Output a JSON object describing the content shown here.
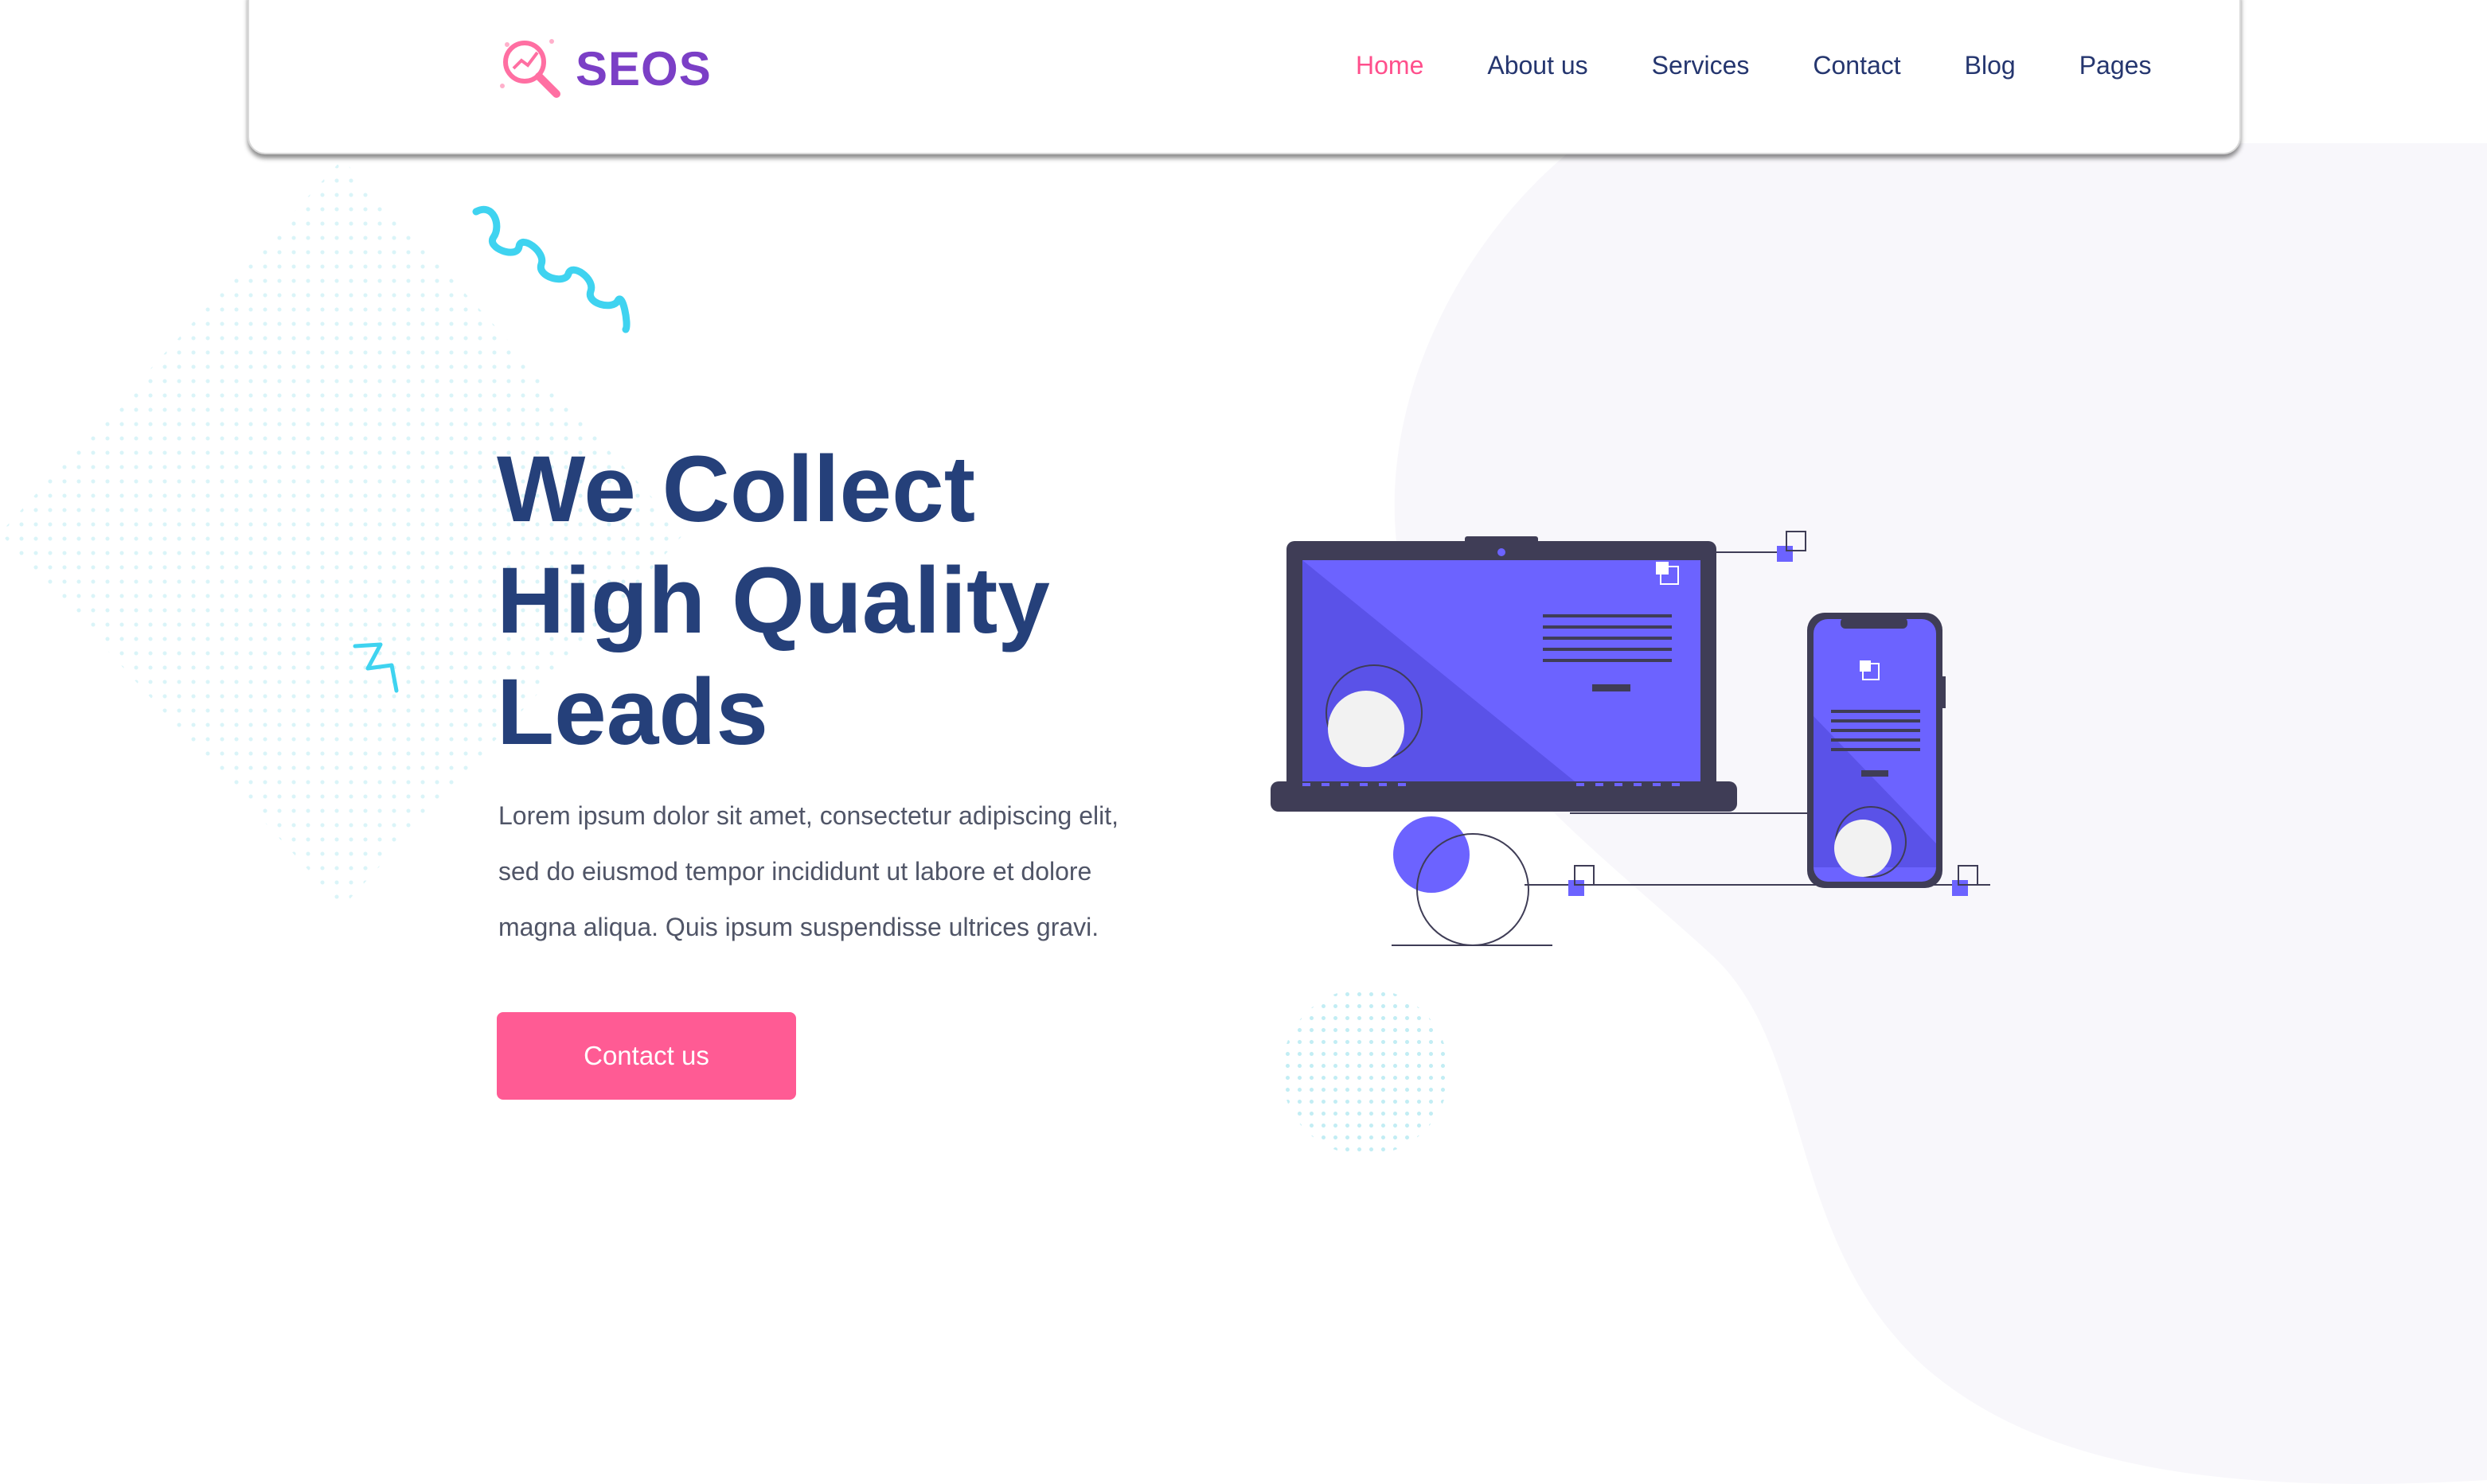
{
  "brand": {
    "name": "SEOS",
    "color": "#7b3fc6",
    "logo_icon": "magnifier-chart-icon",
    "logo_icon_color": "#ff6fa2"
  },
  "nav": {
    "items": [
      {
        "label": "Home",
        "active": true
      },
      {
        "label": "About us",
        "active": false
      },
      {
        "label": "Services",
        "active": false
      },
      {
        "label": "Contact",
        "active": false
      },
      {
        "label": "Blog",
        "active": false
      },
      {
        "label": "Pages",
        "active": false
      }
    ],
    "active_color": "#ff4f8c",
    "text_color": "#25366f"
  },
  "hero": {
    "title_lines": [
      "We Collect",
      "High Quality",
      "Leads"
    ],
    "description_lines": [
      "Lorem ipsum dolor sit amet, consectetur adipiscing elit,",
      "sed do eiusmod tempor incididunt ut labore et dolore",
      "magna aliqua. Quis ipsum suspendisse ultrices gravi."
    ],
    "cta_label": "Contact us",
    "title_color": "#25407a",
    "cta_color": "#ff5b94"
  },
  "illustration": {
    "subject": "laptop-and-phone-devices",
    "accent_color": "#6c63ff",
    "frame_color": "#3f3d56"
  },
  "decorations": {
    "squiggle_color": "#3fd3f0",
    "dots_color": "#78d7e6"
  }
}
